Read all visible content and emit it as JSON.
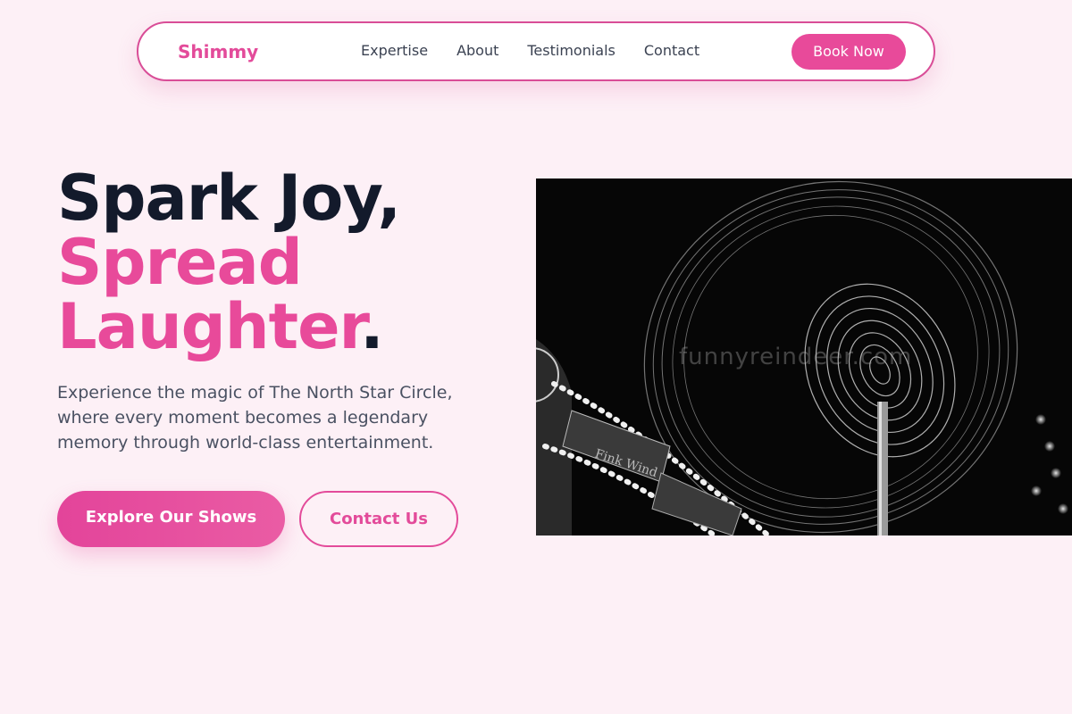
{
  "nav": {
    "brand": "Shimmy",
    "links": [
      "Expertise",
      "About",
      "Testimonials",
      "Contact"
    ],
    "cta": "Book Now"
  },
  "hero": {
    "title_line1": "Spark Joy,",
    "title_line2": "Spread",
    "title_line3": "Laughter",
    "title_period": ".",
    "description": "Experience the magic of The North Star Circle, where every moment becomes a legendary memory through world-class entertainment.",
    "primary_button": "Explore Our Shows",
    "secondary_button": "Contact Us"
  },
  "image": {
    "alt": "Spinning carnival ride at night with long-exposure light trails",
    "watermark": "funnyreindeer.com",
    "sign_text": "Fink Wind"
  },
  "colors": {
    "accent": "#e84a9a",
    "heading": "#131a2b",
    "body_text": "#4a5162",
    "background": "#fdf0f6"
  }
}
